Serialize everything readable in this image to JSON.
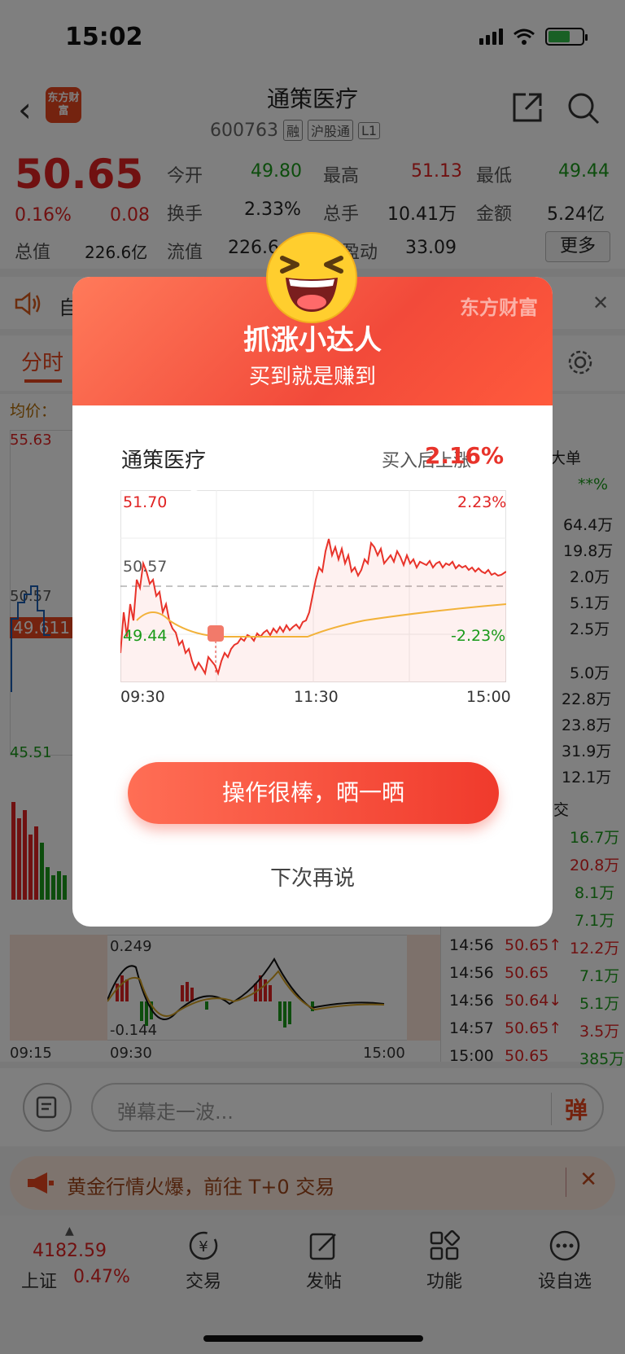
{
  "status": {
    "time": "15:02"
  },
  "header": {
    "title": "通策医疗",
    "code": "600763",
    "tags": [
      "融",
      "沪股通",
      "L1"
    ],
    "logo_text": "东方财富"
  },
  "quote": {
    "price": "50.65",
    "pct": "0.16%",
    "change": "0.08",
    "fields": [
      {
        "label": "今开",
        "value": "49.80"
      },
      {
        "label": "最高",
        "value": "51.13"
      },
      {
        "label": "最低",
        "value": "49.44"
      },
      {
        "label": "换手",
        "value": "2.33%"
      },
      {
        "label": "总手",
        "value": "10.41万"
      },
      {
        "label": "金额",
        "value": "5.24亿"
      },
      {
        "label": "总值",
        "value": "226.6亿"
      },
      {
        "label": "流值",
        "value": "226.6"
      },
      {
        "label": "盈动",
        "value": "33.09"
      }
    ],
    "more": "更多"
  },
  "bg": {
    "tab_fenshi": "分时",
    "avg_label": "均价：",
    "axis_top": "55.63",
    "axis_bottom": "45.51",
    "axis_mid": "50.57",
    "axis_cur": "49.611",
    "macd_top": "0.249",
    "macd_bottom": "-0.144",
    "time_labels": [
      "09:15",
      "09:30",
      "15:00"
    ],
    "big_order_header": "大单",
    "big_order_sub": "**%",
    "big_orders": [
      "64.4万",
      "19.8万",
      "2.0万",
      "5.1万",
      "2.5万",
      "5.0万",
      "22.8万",
      "23.8万",
      "31.9万",
      "12.1万"
    ],
    "deal_header": "交",
    "deals_right": [
      "16.7万",
      "20.8万",
      "8.1万",
      "7.1万"
    ],
    "ticks": [
      {
        "time": "14:56",
        "price": "50.65↑",
        "vol": "12.2万"
      },
      {
        "time": "14:56",
        "price": "50.65",
        "vol": "7.1万"
      },
      {
        "time": "14:56",
        "price": "50.64↓",
        "vol": "5.1万"
      },
      {
        "time": "14:57",
        "price": "50.65↑",
        "vol": "3.5万"
      },
      {
        "time": "15:00",
        "price": "50.65",
        "vol": "385万"
      }
    ],
    "notice_icon": "speaker-icon",
    "notice_prefix": "自"
  },
  "comment": {
    "placeholder": "弹幕走一波...",
    "danmu_label": "弹"
  },
  "banner": {
    "text": "黄金行情火爆，前往 T+0 交易"
  },
  "index": {
    "value": "4182.59",
    "name": "上证",
    "pct": "0.47%"
  },
  "tabs": [
    {
      "label": "交易",
      "icon": "trade-icon"
    },
    {
      "label": "发帖",
      "icon": "post-icon"
    },
    {
      "label": "功能",
      "icon": "grid-icon"
    },
    {
      "label": "设自选",
      "icon": "more-icon"
    }
  ],
  "modal": {
    "brand": "东方财富",
    "title": "抓涨小达人",
    "subtitle": "买到就是赚到",
    "stock": "通策医疗",
    "rise_label": "买入后上涨",
    "rise_value": "2.16%",
    "chart_max": "51.70",
    "chart_min": "49.44",
    "chart_mid": "50.57",
    "pct_max": "2.23%",
    "pct_min": "-2.23%",
    "times": [
      "09:30",
      "11:30",
      "15:00"
    ],
    "buy_marker": "B",
    "cta": "操作很棒，晒一晒",
    "later": "下次再说"
  },
  "colors": {
    "accent": "#e02222",
    "up": "#e02222",
    "down": "#1a9a1a",
    "modal_red": "#f24a3a"
  }
}
